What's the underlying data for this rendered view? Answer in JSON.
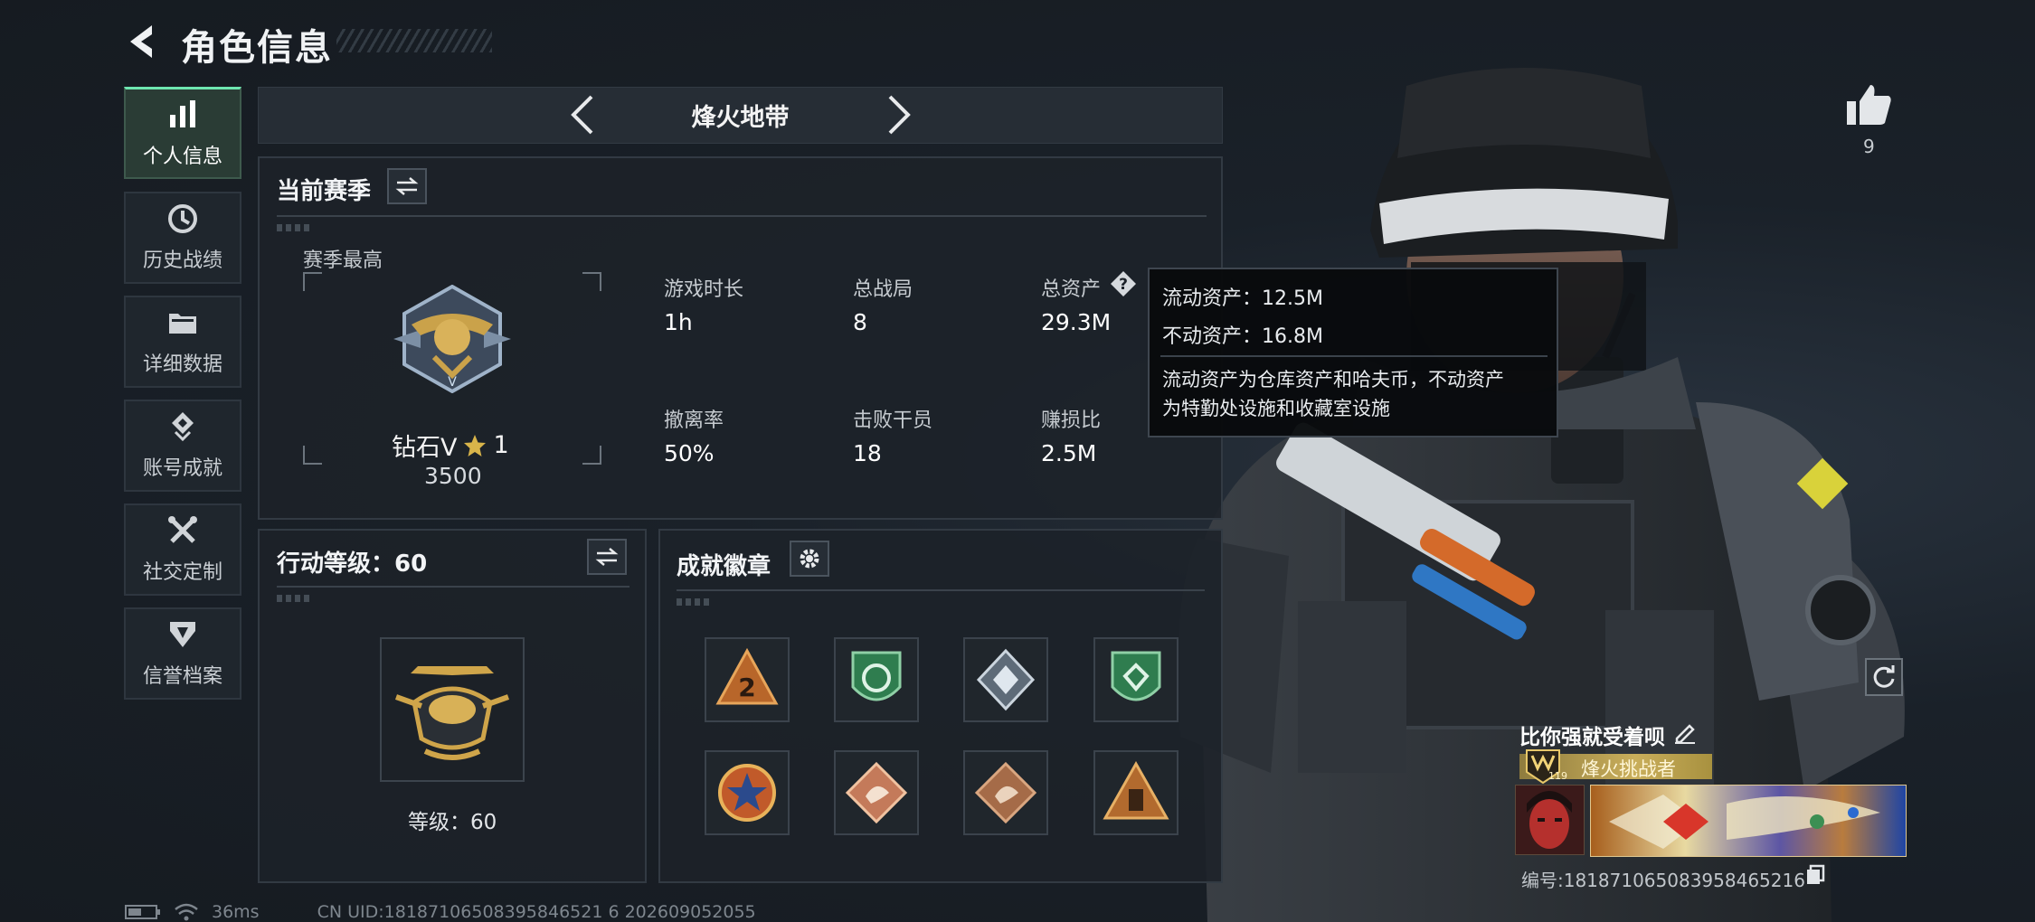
{
  "header": {
    "title": "角色信息"
  },
  "nav": {
    "items": [
      {
        "label": "个人信息",
        "icon": "bar-chart-icon",
        "active": true
      },
      {
        "label": "历史战绩",
        "icon": "history-clock-icon",
        "active": false
      },
      {
        "label": "详细数据",
        "icon": "folder-icon",
        "active": false
      },
      {
        "label": "账号成就",
        "icon": "achievement-icon",
        "active": false
      },
      {
        "label": "社交定制",
        "icon": "tools-icon",
        "active": false
      },
      {
        "label": "信誉档案",
        "icon": "shield-badge-icon",
        "active": false
      }
    ]
  },
  "mode": {
    "name": "烽火地带"
  },
  "season": {
    "title": "当前赛季",
    "best_label": "赛季最高",
    "rank_name": "钻石V",
    "rank_stars": "1",
    "rank_score": "3500",
    "stats": [
      {
        "label": "游戏时长",
        "value": "1h"
      },
      {
        "label": "总战局",
        "value": "8"
      },
      {
        "label": "总资产",
        "value": "29.3M"
      },
      {
        "label": "撤离率",
        "value": "50%"
      },
      {
        "label": "击败干员",
        "value": "18"
      },
      {
        "label": "赚损比",
        "value": "2.5M"
      }
    ]
  },
  "asset_tooltip": {
    "liquid": "流动资产：12.5M",
    "fixed": "不动资产：16.8M",
    "desc_line1": "流动资产为仓库资产和哈夫币，不动资产",
    "desc_line2": "为特勤处设施和收藏室设施"
  },
  "action_level": {
    "title": "行动等级：60",
    "level_text": "等级：60"
  },
  "badges": {
    "title": "成就徽章",
    "items": [
      {
        "icon": "triangle-2-badge-icon",
        "color": "#b8662a"
      },
      {
        "icon": "green-shield-badge-icon",
        "color": "#2f7d4f"
      },
      {
        "icon": "diamond-crystal-badge-icon",
        "color": "#8a9aa8"
      },
      {
        "icon": "green-shield-badge-icon",
        "color": "#2f7d4f"
      },
      {
        "icon": "star-circle-badge-icon",
        "color": "#c15a2a"
      },
      {
        "icon": "beast-diamond-badge-icon",
        "color": "#c47a5a"
      },
      {
        "icon": "beast-diamond-badge-icon",
        "color": "#a56b48"
      },
      {
        "icon": "pyramid-badge-icon",
        "color": "#b26a2e"
      }
    ]
  },
  "profile": {
    "like_count": "9",
    "player_name": "比你强就受着呗",
    "title_tag": "烽火挑战者",
    "title_level": "119",
    "player_id": "编号:1818710650839584652​16"
  },
  "status_bar": {
    "ping": "36ms",
    "uid": "CN UID:18187106508395846521 6 202609052055"
  },
  "colors": {
    "accent": "#6ee6b0",
    "panel_bg": "#1c2229",
    "border": "#323a43"
  }
}
